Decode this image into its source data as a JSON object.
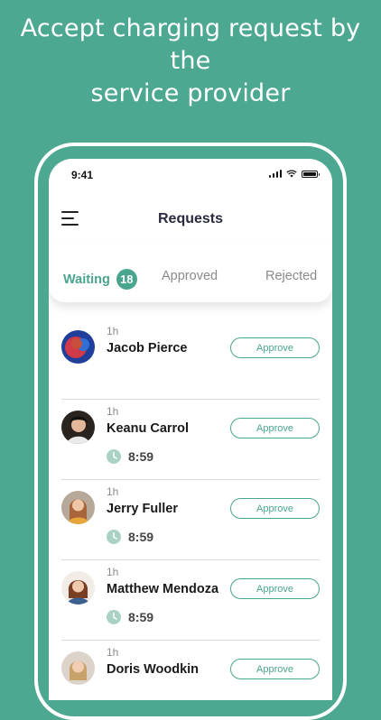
{
  "headline": {
    "line1": "Accept charging request by the",
    "line2": "service provider"
  },
  "status_bar": {
    "time": "9:41",
    "icons": [
      "signal-icon",
      "wifi-icon",
      "battery-icon"
    ]
  },
  "header": {
    "title": "Requests",
    "menu_icon": "hamburger-menu-icon"
  },
  "tabs": [
    {
      "label": "Waiting",
      "count": "18",
      "active": true
    },
    {
      "label": "Approved",
      "active": false
    },
    {
      "label": "Rejected",
      "active": false
    }
  ],
  "requests": [
    {
      "time_ago": "1h",
      "name": "Jacob Pierce",
      "timer": "",
      "action": "Approve"
    },
    {
      "time_ago": "1h",
      "name": "Keanu Carrol",
      "timer": "8:59",
      "action": "Approve"
    },
    {
      "time_ago": "1h",
      "name": "Jerry Fuller",
      "timer": "8:59",
      "action": "Approve"
    },
    {
      "time_ago": "1h",
      "name": "Matthew Mendoza",
      "timer": "8:59",
      "action": "Approve"
    },
    {
      "time_ago": "1h",
      "name": "Doris Woodkin",
      "timer": "",
      "action": "Approve"
    }
  ],
  "colors": {
    "background": "#4da891",
    "accent": "#4aa58e",
    "text_dark": "#1a1a1a",
    "text_muted": "#8a8a8a"
  }
}
